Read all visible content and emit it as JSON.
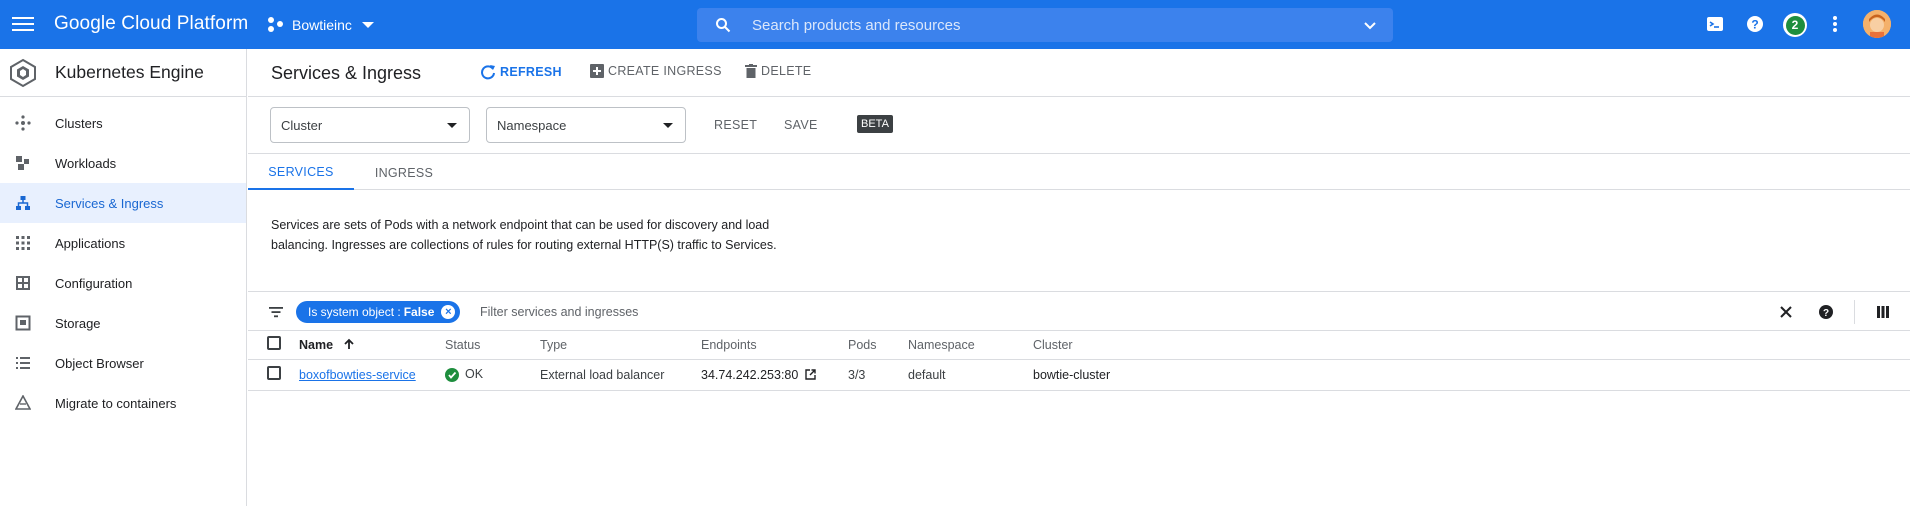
{
  "topbar": {
    "brand": "Google Cloud Platform",
    "project": "Bowtieinc",
    "search_placeholder": "Search products and resources",
    "notifications_count": "2",
    "colors": {
      "bar": "#1a73e8",
      "badge": "#1e8e3e"
    }
  },
  "sidebar": {
    "title": "Kubernetes Engine",
    "items": [
      {
        "label": "Clusters",
        "icon": "clusters-icon"
      },
      {
        "label": "Workloads",
        "icon": "workloads-icon"
      },
      {
        "label": "Services & Ingress",
        "icon": "services-icon",
        "active": true
      },
      {
        "label": "Applications",
        "icon": "applications-icon"
      },
      {
        "label": "Configuration",
        "icon": "configuration-icon"
      },
      {
        "label": "Storage",
        "icon": "storage-icon"
      },
      {
        "label": "Object Browser",
        "icon": "object-browser-icon"
      },
      {
        "label": "Migrate to containers",
        "icon": "migrate-icon"
      }
    ]
  },
  "page": {
    "title": "Services & Ingress",
    "actions": {
      "refresh": "REFRESH",
      "create_ingress": "CREATE INGRESS",
      "delete": "DELETE"
    }
  },
  "filters": {
    "cluster": "Cluster",
    "namespace": "Namespace",
    "reset": "RESET",
    "save": "SAVE",
    "beta": "BETA"
  },
  "tabs": {
    "services": "SERVICES",
    "ingress": "INGRESS",
    "active": "services"
  },
  "description": "Services are sets of Pods with a network endpoint that can be used for discovery and load balancing. Ingresses are collections of rules for routing external HTTP(S) traffic to Services.",
  "filterbar": {
    "chip_key": "Is system object :",
    "chip_value": "False",
    "placeholder": "Filter services and ingresses"
  },
  "table": {
    "headers": {
      "name": "Name",
      "status": "Status",
      "type": "Type",
      "endpoints": "Endpoints",
      "pods": "Pods",
      "namespace": "Namespace",
      "cluster": "Cluster"
    },
    "rows": [
      {
        "name": "boxofbowties-service",
        "status": "OK",
        "type": "External load balancer",
        "endpoints": "34.74.242.253:80",
        "pods": "3/3",
        "namespace": "default",
        "cluster": "bowtie-cluster"
      }
    ]
  }
}
